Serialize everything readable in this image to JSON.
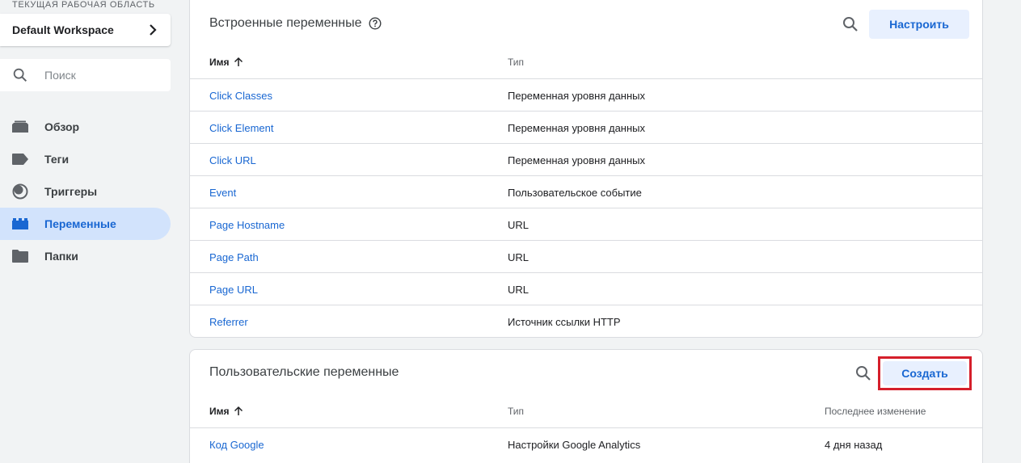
{
  "sidebar": {
    "workspace_label": "ТЕКУЩАЯ РАБОЧАЯ ОБЛАСТЬ",
    "workspace_name": "Default Workspace",
    "search_placeholder": "Поиск",
    "items": [
      {
        "label": "Обзор",
        "icon": "overview-icon"
      },
      {
        "label": "Теги",
        "icon": "tag-icon"
      },
      {
        "label": "Триггеры",
        "icon": "trigger-icon"
      },
      {
        "label": "Переменные",
        "icon": "variables-icon",
        "active": true
      },
      {
        "label": "Папки",
        "icon": "folder-icon"
      }
    ]
  },
  "builtin": {
    "title": "Встроенные переменные",
    "configure_label": "Настроить",
    "col_name": "Имя",
    "col_type": "Тип",
    "rows": [
      {
        "name": "Click Classes",
        "type": "Переменная уровня данных"
      },
      {
        "name": "Click Element",
        "type": "Переменная уровня данных"
      },
      {
        "name": "Click URL",
        "type": "Переменная уровня данных"
      },
      {
        "name": "Event",
        "type": "Пользовательское событие"
      },
      {
        "name": "Page Hostname",
        "type": "URL"
      },
      {
        "name": "Page Path",
        "type": "URL"
      },
      {
        "name": "Page URL",
        "type": "URL"
      },
      {
        "name": "Referrer",
        "type": "Источник ссылки HTTP"
      }
    ]
  },
  "user": {
    "title": "Пользовательские переменные",
    "create_label": "Создать",
    "col_name": "Имя",
    "col_type": "Тип",
    "col_modified": "Последнее изменение",
    "rows": [
      {
        "name": "Код Google",
        "type": "Настройки Google Analytics",
        "modified": "4 дня назад"
      }
    ]
  },
  "colors": {
    "accent": "#1967d2",
    "active_bg": "#d2e3fc",
    "button_bg": "#e8f0fe",
    "highlight": "#d51f2b"
  }
}
